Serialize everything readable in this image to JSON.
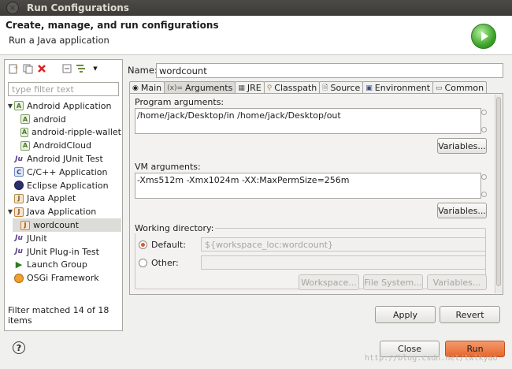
{
  "window": {
    "title": "Run Configurations"
  },
  "header": {
    "title": "Create, manage, and run configurations",
    "subtitle": "Run a Java application"
  },
  "left": {
    "filter_placeholder": "type filter text",
    "tree": [
      {
        "label": "Android Application",
        "level": 0,
        "expanded": true,
        "icon": "android-app-icon"
      },
      {
        "label": "android",
        "level": 1,
        "icon": "android-config-icon"
      },
      {
        "label": "android-ripple-wallet",
        "level": 1,
        "icon": "android-config-icon"
      },
      {
        "label": "AndroidCloud",
        "level": 1,
        "icon": "android-config-icon"
      },
      {
        "label": "Android JUnit Test",
        "level": 0,
        "icon": "android-junit-icon"
      },
      {
        "label": "C/C++ Application",
        "level": 0,
        "icon": "c-app-icon"
      },
      {
        "label": "Eclipse Application",
        "level": 0,
        "icon": "eclipse-icon"
      },
      {
        "label": "Java Applet",
        "level": 0,
        "icon": "applet-icon"
      },
      {
        "label": "Java Application",
        "level": 0,
        "expanded": true,
        "icon": "java-app-icon"
      },
      {
        "label": "wordcount",
        "level": 1,
        "selected": true,
        "icon": "java-config-icon"
      },
      {
        "label": "JUnit",
        "level": 0,
        "icon": "junit-icon"
      },
      {
        "label": "JUnit Plug-in Test",
        "level": 0,
        "icon": "junit-plugin-icon"
      },
      {
        "label": "Launch Group",
        "level": 0,
        "icon": "launch-group-icon"
      },
      {
        "label": "OSGi Framework",
        "level": 0,
        "icon": "osgi-icon"
      }
    ],
    "status": "Filter matched 14 of 18 items"
  },
  "config": {
    "name_label": "Name:",
    "name_value": "wordcount",
    "tabs": [
      {
        "label": "Main",
        "icon": "main-tab-icon"
      },
      {
        "label": "Arguments",
        "icon": "arguments-tab-icon",
        "active": true
      },
      {
        "label": "JRE",
        "icon": "jre-tab-icon"
      },
      {
        "label": "Classpath",
        "icon": "classpath-tab-icon"
      },
      {
        "label": "Source",
        "icon": "source-tab-icon"
      },
      {
        "label": "Environment",
        "icon": "environment-tab-icon"
      },
      {
        "label": "Common",
        "icon": "common-tab-icon"
      }
    ],
    "program_args_label": "Program arguments:",
    "program_args": "/home/jack/Desktop/in /home/jack/Desktop/out",
    "vm_args_label": "VM arguments:",
    "vm_args": "-Xms512m -Xmx1024m -XX:MaxPermSize=256m",
    "variables_label": "Variables...",
    "working_dir_label": "Working directory:",
    "default_label": "Default:",
    "default_value": "${workspace_loc:wordcount}",
    "other_label": "Other:",
    "workspace_btn": "Workspace...",
    "filesystem_btn": "File System...",
    "apply": "Apply",
    "revert": "Revert"
  },
  "footer": {
    "close": "Close",
    "run": "Run",
    "help": "?"
  },
  "watermark": "http://blog.csdn.net/twlkyao",
  "colors": {
    "titlebar": "#3c3b37",
    "run_button": "#e7672e",
    "radio_dot": "#e2572a"
  }
}
